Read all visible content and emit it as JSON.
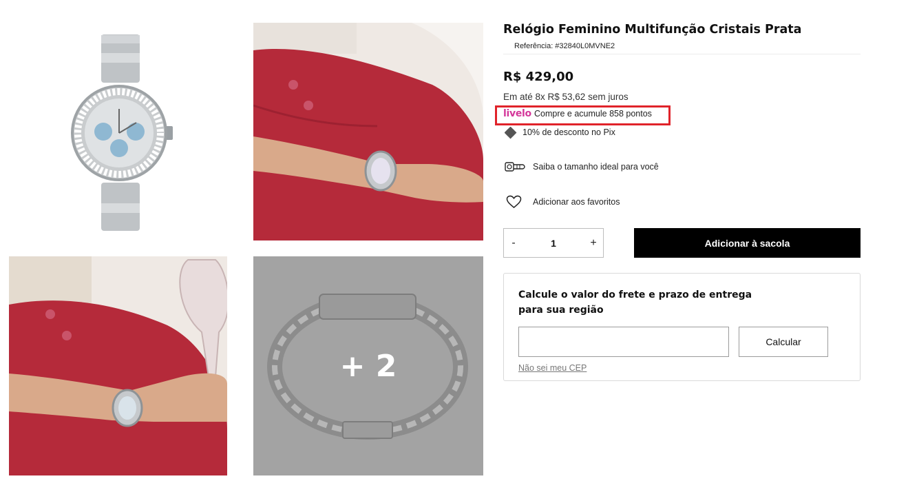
{
  "gallery": {
    "more_photos_label": "+ 2"
  },
  "product": {
    "title": "Relógio Feminino Multifunção Cristais Prata",
    "reference": "Referência: #32840L0MVNE2",
    "price": "R$ 429,00",
    "installments": "Em até 8x R$ 53,62 sem juros",
    "livelo_logo": "livelo",
    "livelo_text": "Compre e acumule 858 pontos",
    "pix_text": "10% de desconto no Pix",
    "size_guide": "Saiba o tamanho ideal para você",
    "favorites": "Adicionar aos favoritos"
  },
  "quantity": {
    "minus": "-",
    "value": "1",
    "plus": "+"
  },
  "add_to_bag_label": "Adicionar à sacola",
  "shipping": {
    "title": "Calcule o valor do frete e prazo de entrega para sua região",
    "input_value": "",
    "input_placeholder": "",
    "calc_label": "Calcular",
    "cep_link": "Não sei meu CEP"
  },
  "colors": {
    "livelo_pink": "#d4389a",
    "highlight_red": "#e0232a",
    "button_black": "#000000",
    "skirt_red": "#b52a3a"
  }
}
